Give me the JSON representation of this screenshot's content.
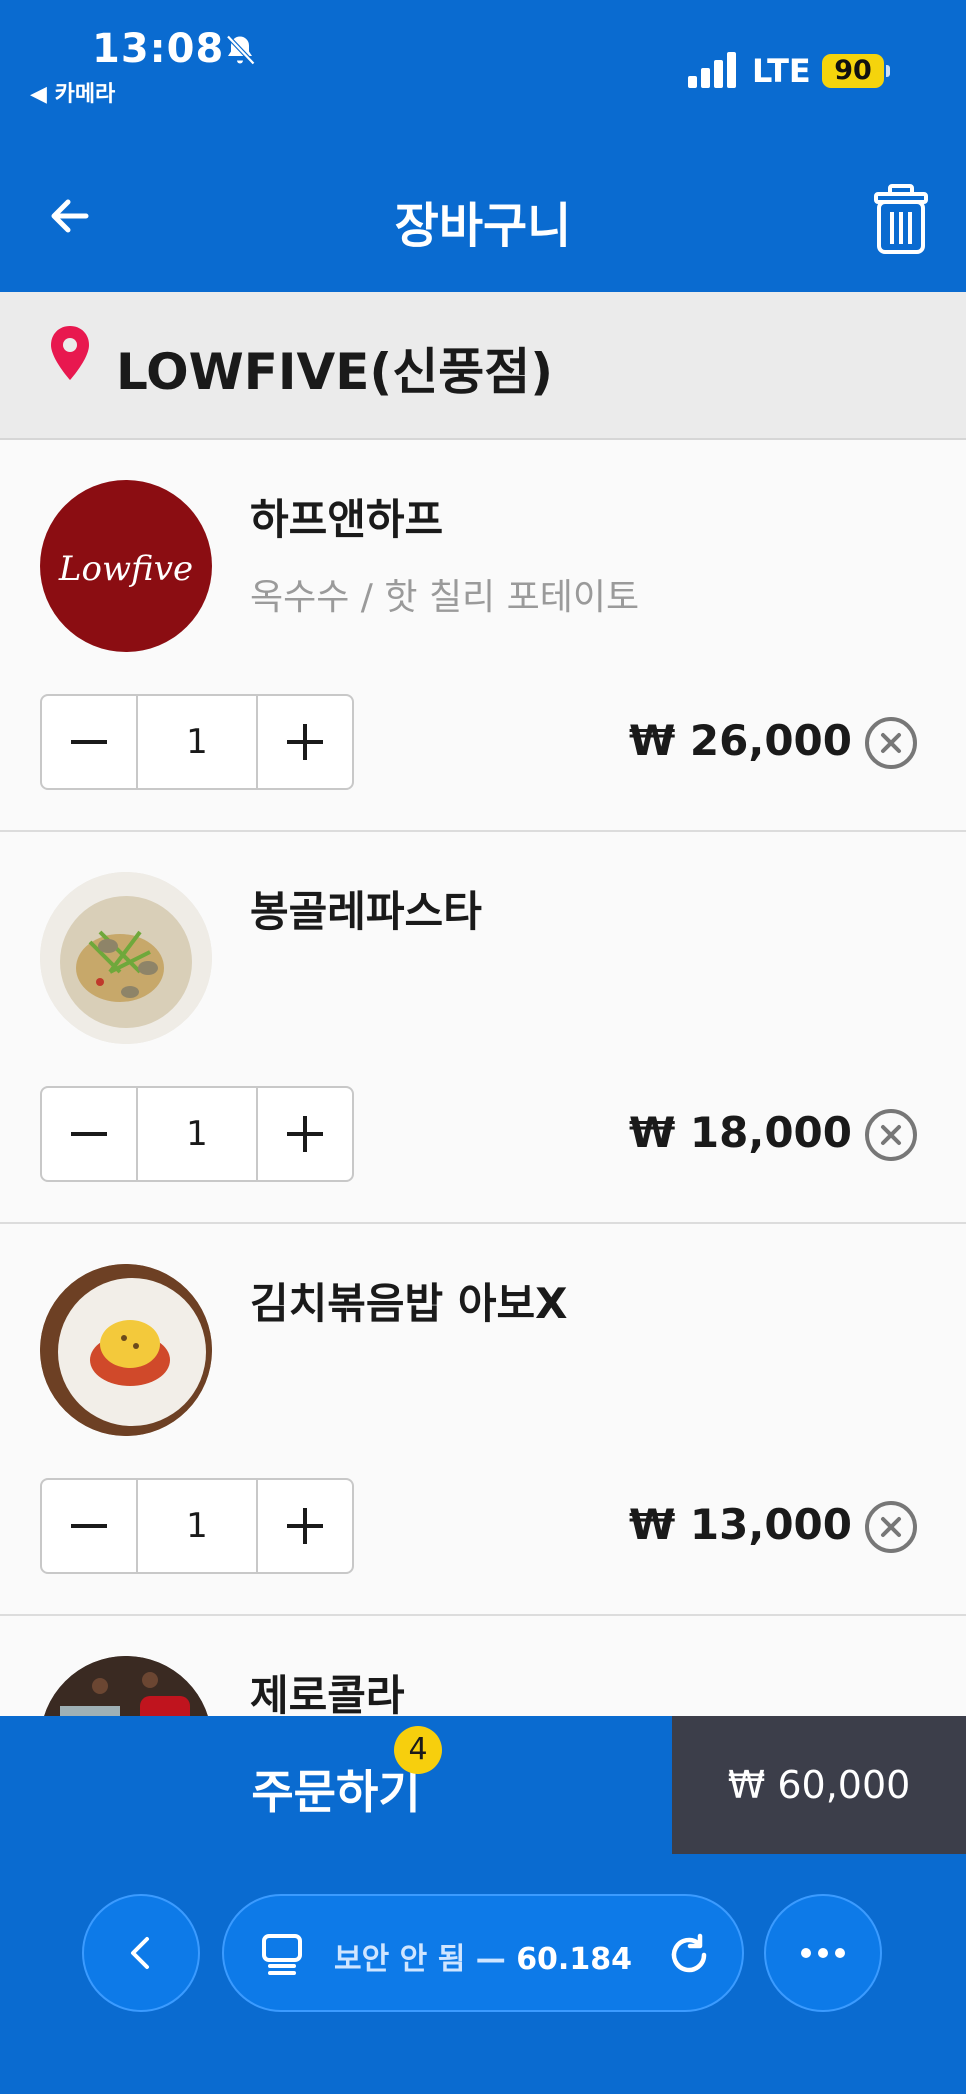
{
  "status_bar": {
    "time": "13:08",
    "back_app": "◀ 카메라",
    "network": "LTE",
    "battery": "90"
  },
  "header": {
    "title": "장바구니",
    "back_icon": "arrow-left-icon",
    "trash_icon": "trash-icon"
  },
  "store": {
    "name": "LOWFIVE(신풍점)",
    "icon": "location-pin-icon"
  },
  "items": [
    {
      "name": "하프앤하프",
      "options": "옥수수 / 핫 칠리 포테이토",
      "quantity": "1",
      "price": "₩ 26,000",
      "logo_text": "Lowfive"
    },
    {
      "name": "봉골레파스타",
      "options": "",
      "quantity": "1",
      "price": "₩ 18,000"
    },
    {
      "name": "김치볶음밥 아보X",
      "options": "",
      "quantity": "1",
      "price": "₩ 13,000"
    },
    {
      "name": "제로콜라",
      "options": "",
      "quantity": "",
      "price": ""
    }
  ],
  "order": {
    "label": "주문하기",
    "badge_count": "4",
    "total": "₩ 60,000"
  },
  "browser": {
    "url_text": "보안 안 됨 — ",
    "url_ip": "60.184"
  },
  "colors": {
    "brand_blue": "#0a6bd0",
    "total_bg": "#3c3e4a",
    "badge": "#f7cf0d",
    "pin": "#e8184f",
    "logo_red": "#8b0d12"
  }
}
